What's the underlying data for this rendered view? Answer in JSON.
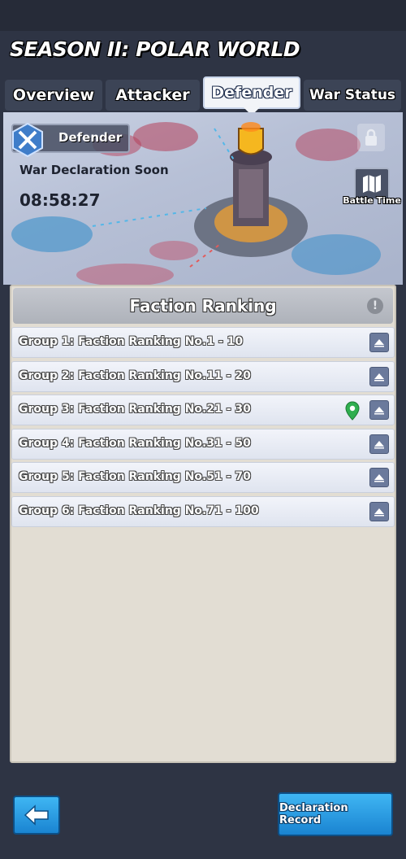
{
  "header": {
    "season_title": "SEASON II: POLAR WORLD"
  },
  "tabs": [
    {
      "label": "Overview",
      "active": false
    },
    {
      "label": "Attacker",
      "active": false
    },
    {
      "label": "Defender",
      "active": true
    },
    {
      "label": "War Status",
      "active": false
    }
  ],
  "banner": {
    "role_label": "Defender",
    "status_text": "War Declaration Soon",
    "countdown": "08:58:27",
    "battle_time_label": "Battle Time",
    "icons": {
      "role": "crossed-swords-icon",
      "battle_time": "map-icon",
      "lock": "lock-icon",
      "tower": "shield-tower-icon"
    }
  },
  "panel": {
    "title": "Faction Ranking",
    "info_icon": "!",
    "groups": [
      {
        "label": "Group 1: Faction Ranking No.1 - 10",
        "current": false
      },
      {
        "label": "Group 2: Faction Ranking No.11 - 20",
        "current": false
      },
      {
        "label": "Group 3: Faction Ranking No.21 - 30",
        "current": true
      },
      {
        "label": "Group 4: Faction Ranking No.31 - 50",
        "current": false
      },
      {
        "label": "Group 5: Faction Ranking No.51 - 70",
        "current": false
      },
      {
        "label": "Group 6: Faction Ranking No.71 - 100",
        "current": false
      }
    ]
  },
  "footer": {
    "declaration_record_label": "Declaration Record"
  },
  "colors": {
    "accent_blue": "#1a84d1",
    "location_green": "#2fae4f",
    "background": "#2e3444"
  }
}
